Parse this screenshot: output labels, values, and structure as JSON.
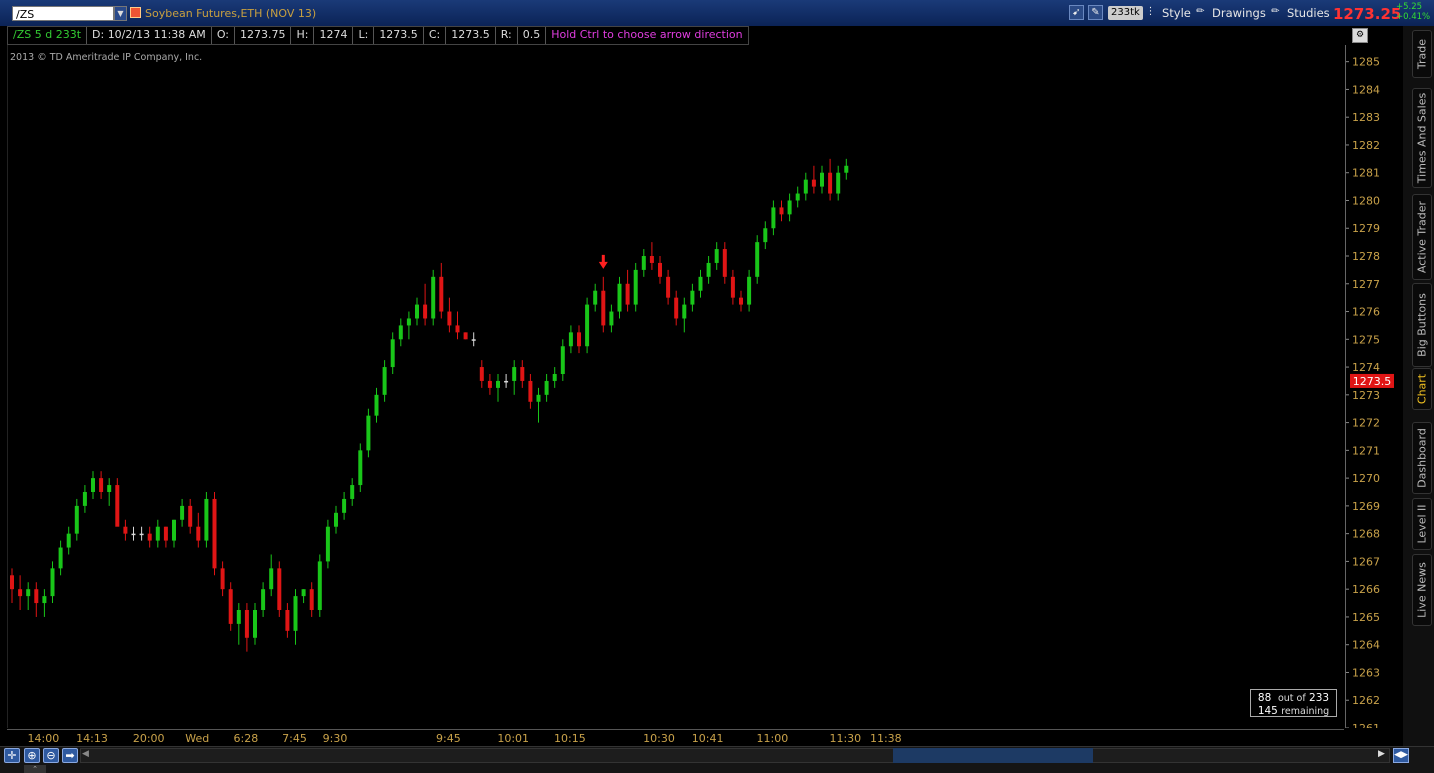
{
  "toolbar": {
    "symbol": "/ZS",
    "title": "Soybean Futures,ETH (NOV 13)",
    "aggregation_badge": "233tk",
    "style_label": "Style",
    "drawings_label": "Drawings",
    "studies_label": "Studies",
    "last_price": "1273.25",
    "net_change": "+5.25",
    "net_change_pct": "+0.41%",
    "colors": {
      "bar_bg": "#0b2356",
      "last_price": "#ff3333",
      "net_change": "#33dd33"
    }
  },
  "infobar": {
    "symbol_period": "/ZS 5 d 233t",
    "date": "D: 10/2/13 11:38 AM",
    "o_label": "O:",
    "o_value": "1273.75",
    "h_label": "H:",
    "h_value": "1274",
    "l_label": "L:",
    "l_value": "1273.5",
    "c_label": "C:",
    "c_value": "1273.5",
    "r_label": "R:",
    "r_value": "0.5",
    "hint": "Hold Ctrl to choose arrow direction"
  },
  "copyright": "2013 © TD Ameritrade IP Company, Inc.",
  "right_tabs": [
    {
      "label": "Trade",
      "active": false
    },
    {
      "label": "Times And Sales",
      "active": false
    },
    {
      "label": "Active Trader",
      "active": false
    },
    {
      "label": "Big Buttons",
      "active": false
    },
    {
      "label": "Chart",
      "active": true
    },
    {
      "label": "Dashboard",
      "active": false
    },
    {
      "label": "Level II",
      "active": false
    },
    {
      "label": "Live News",
      "active": false
    }
  ],
  "counter": {
    "shown": "88",
    "out_of_label": "out of",
    "total": "233",
    "remaining": "145",
    "remaining_label": "remaining"
  },
  "chart_data": {
    "type": "candlestick",
    "ylim": [
      1261,
      1285.6
    ],
    "y_ticks": [
      1285,
      1284,
      1283,
      1282,
      1281,
      1280,
      1279,
      1278,
      1277,
      1276,
      1275,
      1274,
      1273,
      1272,
      1271,
      1270,
      1269,
      1268,
      1267,
      1266,
      1265,
      1264,
      1263,
      1262,
      1261
    ],
    "x_tick_labels": [
      "14:00",
      "14:13",
      "20:00",
      "Wed",
      "6:28",
      "7:45",
      "9:30",
      "9:45",
      "10:01",
      "10:15",
      "10:30",
      "10:41",
      "11:00",
      "11:30",
      "11:38"
    ],
    "x_tick_bar_index": [
      4,
      10,
      17,
      23,
      29,
      35,
      40,
      54,
      62,
      69,
      80,
      86,
      94,
      103,
      108
    ],
    "bar_count": 104,
    "last_price_label": "1273.5",
    "colors": {
      "up": "#19c619",
      "down": "#e01515",
      "neutral": "#d8d8d8",
      "marker": "#ff2020",
      "axis_text": "#c9a24a"
    },
    "arrow_marker": {
      "bar_index": 73,
      "direction": "down"
    },
    "ohlc": [
      [
        1266.5,
        1266.75,
        1265.5,
        1266.0
      ],
      [
        1266.0,
        1266.5,
        1265.25,
        1265.75
      ],
      [
        1265.75,
        1266.25,
        1265.25,
        1266.0
      ],
      [
        1266.0,
        1266.25,
        1265.0,
        1265.5
      ],
      [
        1265.5,
        1266.0,
        1265.0,
        1265.75
      ],
      [
        1265.75,
        1267.0,
        1265.5,
        1266.75
      ],
      [
        1266.75,
        1267.75,
        1266.5,
        1267.5
      ],
      [
        1267.5,
        1268.25,
        1267.25,
        1268.0
      ],
      [
        1268.0,
        1269.25,
        1267.75,
        1269.0
      ],
      [
        1269.0,
        1269.75,
        1268.75,
        1269.5
      ],
      [
        1269.5,
        1270.25,
        1269.25,
        1270.0
      ],
      [
        1270.0,
        1270.25,
        1269.25,
        1269.5
      ],
      [
        1269.5,
        1270.0,
        1269.0,
        1269.75
      ],
      [
        1269.75,
        1270.0,
        1268.5,
        1268.25
      ],
      [
        1268.25,
        1268.5,
        1267.75,
        1268.0
      ],
      [
        1268.0,
        1268.25,
        1267.75,
        1268.0
      ],
      [
        1268.0,
        1268.25,
        1267.75,
        1268.0
      ],
      [
        1268.0,
        1268.25,
        1267.5,
        1267.75
      ],
      [
        1267.75,
        1268.5,
        1267.5,
        1268.25
      ],
      [
        1268.25,
        1268.25,
        1267.5,
        1267.75
      ],
      [
        1267.75,
        1268.5,
        1267.5,
        1268.5
      ],
      [
        1268.5,
        1269.25,
        1268.25,
        1269.0
      ],
      [
        1269.0,
        1269.25,
        1268.0,
        1268.25
      ],
      [
        1268.25,
        1268.75,
        1267.5,
        1267.75
      ],
      [
        1267.75,
        1269.5,
        1267.5,
        1269.25
      ],
      [
        1269.25,
        1269.5,
        1266.5,
        1266.75
      ],
      [
        1266.75,
        1267.0,
        1265.75,
        1266.0
      ],
      [
        1266.0,
        1266.25,
        1264.5,
        1264.75
      ],
      [
        1264.75,
        1265.5,
        1264.0,
        1265.25
      ],
      [
        1265.25,
        1265.5,
        1263.75,
        1264.25
      ],
      [
        1264.25,
        1265.5,
        1264.0,
        1265.25
      ],
      [
        1265.25,
        1266.25,
        1265.0,
        1266.0
      ],
      [
        1266.0,
        1267.25,
        1265.75,
        1266.75
      ],
      [
        1266.75,
        1267.0,
        1265.0,
        1265.25
      ],
      [
        1265.25,
        1265.5,
        1264.25,
        1264.5
      ],
      [
        1264.5,
        1266.0,
        1264.0,
        1265.75
      ],
      [
        1265.75,
        1266.0,
        1265.5,
        1266.0
      ],
      [
        1266.0,
        1266.25,
        1265.0,
        1265.25
      ],
      [
        1265.25,
        1267.25,
        1265.0,
        1267.0
      ],
      [
        1267.0,
        1268.5,
        1266.75,
        1268.25
      ],
      [
        1268.25,
        1269.0,
        1268.0,
        1268.75
      ],
      [
        1268.75,
        1269.5,
        1268.5,
        1269.25
      ],
      [
        1269.25,
        1270.0,
        1269.0,
        1269.75
      ],
      [
        1269.75,
        1271.25,
        1269.5,
        1271.0
      ],
      [
        1271.0,
        1272.5,
        1270.75,
        1272.25
      ],
      [
        1272.25,
        1273.25,
        1272.0,
        1273.0
      ],
      [
        1273.0,
        1274.25,
        1272.75,
        1274.0
      ],
      [
        1274.0,
        1275.25,
        1273.75,
        1275.0
      ],
      [
        1275.0,
        1275.75,
        1274.75,
        1275.5
      ],
      [
        1275.5,
        1276.0,
        1275.0,
        1275.75
      ],
      [
        1275.75,
        1276.5,
        1275.5,
        1276.25
      ],
      [
        1276.25,
        1277.0,
        1275.5,
        1275.75
      ],
      [
        1275.75,
        1277.5,
        1275.5,
        1277.25
      ],
      [
        1277.25,
        1277.75,
        1275.75,
        1276.0
      ],
      [
        1276.0,
        1276.5,
        1275.25,
        1275.5
      ],
      [
        1275.5,
        1276.0,
        1275.0,
        1275.25
      ],
      [
        1275.25,
        1275.25,
        1275.0,
        1275.0
      ],
      [
        1275.0,
        1275.25,
        1274.75,
        1275.0
      ],
      [
        1274.0,
        1274.25,
        1273.25,
        1273.5
      ],
      [
        1273.5,
        1273.75,
        1273.0,
        1273.25
      ],
      [
        1273.25,
        1273.75,
        1272.75,
        1273.5
      ],
      [
        1273.5,
        1273.75,
        1273.25,
        1273.5
      ],
      [
        1273.5,
        1274.25,
        1273.0,
        1274.0
      ],
      [
        1274.0,
        1274.25,
        1273.25,
        1273.5
      ],
      [
        1273.5,
        1273.75,
        1272.5,
        1272.75
      ],
      [
        1272.75,
        1273.25,
        1272.0,
        1273.0
      ],
      [
        1273.0,
        1273.75,
        1272.75,
        1273.5
      ],
      [
        1273.5,
        1274.0,
        1273.25,
        1273.75
      ],
      [
        1273.75,
        1275.0,
        1273.5,
        1274.75
      ],
      [
        1274.75,
        1275.5,
        1274.5,
        1275.25
      ],
      [
        1275.25,
        1275.5,
        1274.5,
        1274.75
      ],
      [
        1274.75,
        1276.5,
        1274.5,
        1276.25
      ],
      [
        1276.25,
        1277.0,
        1276.0,
        1276.75
      ],
      [
        1276.75,
        1277.25,
        1275.25,
        1275.5
      ],
      [
        1275.5,
        1276.25,
        1275.25,
        1276.0
      ],
      [
        1276.0,
        1277.25,
        1275.75,
        1277.0
      ],
      [
        1277.0,
        1277.5,
        1276.0,
        1276.25
      ],
      [
        1276.25,
        1277.75,
        1276.0,
        1277.5
      ],
      [
        1277.5,
        1278.25,
        1277.25,
        1278.0
      ],
      [
        1278.0,
        1278.5,
        1277.5,
        1277.75
      ],
      [
        1277.75,
        1278.0,
        1277.0,
        1277.25
      ],
      [
        1277.25,
        1277.5,
        1276.25,
        1276.5
      ],
      [
        1276.5,
        1276.75,
        1275.5,
        1275.75
      ],
      [
        1275.75,
        1276.5,
        1275.25,
        1276.25
      ],
      [
        1276.25,
        1277.0,
        1276.0,
        1276.75
      ],
      [
        1276.75,
        1277.5,
        1276.5,
        1277.25
      ],
      [
        1277.25,
        1278.0,
        1277.0,
        1277.75
      ],
      [
        1277.75,
        1278.5,
        1277.5,
        1278.25
      ],
      [
        1278.25,
        1278.5,
        1277.0,
        1277.25
      ],
      [
        1277.25,
        1277.5,
        1276.25,
        1276.5
      ],
      [
        1276.5,
        1276.75,
        1276.0,
        1276.25
      ],
      [
        1276.25,
        1277.5,
        1276.0,
        1277.25
      ],
      [
        1277.25,
        1278.75,
        1277.0,
        1278.5
      ],
      [
        1278.5,
        1279.25,
        1278.25,
        1279.0
      ],
      [
        1279.0,
        1280.0,
        1278.75,
        1279.75
      ],
      [
        1279.75,
        1280.0,
        1279.25,
        1279.5
      ],
      [
        1279.5,
        1280.25,
        1279.25,
        1280.0
      ],
      [
        1280.0,
        1280.5,
        1279.75,
        1280.25
      ],
      [
        1280.25,
        1281.0,
        1280.0,
        1280.75
      ],
      [
        1280.75,
        1281.25,
        1280.25,
        1280.5
      ],
      [
        1280.5,
        1281.25,
        1280.25,
        1281.0
      ],
      [
        1281.0,
        1281.5,
        1280.0,
        1280.25
      ],
      [
        1280.25,
        1281.25,
        1280.0,
        1281.0
      ],
      [
        1281.0,
        1281.5,
        1280.75,
        1281.25
      ]
    ]
  }
}
